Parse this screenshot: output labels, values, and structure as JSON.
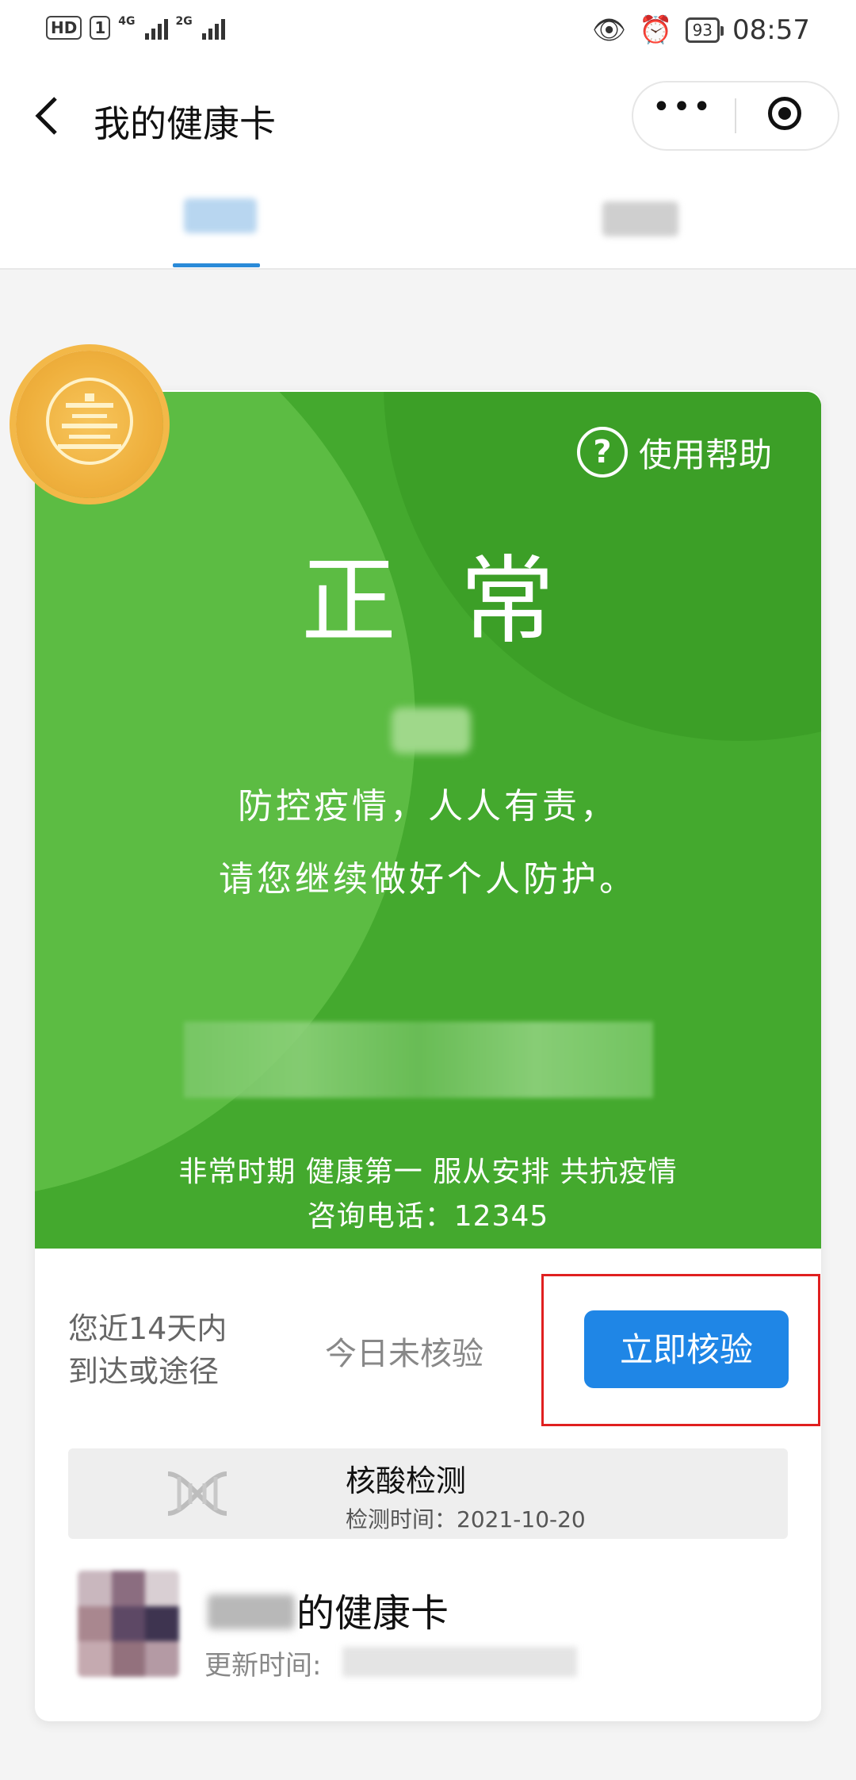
{
  "status_bar": {
    "hd": "HD",
    "sim": "1",
    "net1": "4G",
    "net2": "2G",
    "battery": "93",
    "time": "08:57"
  },
  "header": {
    "back_icon": "chevron-left-icon",
    "title": "我的健康卡",
    "more": "•••"
  },
  "card": {
    "help_label": "使用帮助",
    "status": "正常",
    "slogan_line1": "防控疫情，人人有责，",
    "slogan_line2": "请您继续做好个人防护。",
    "footer_line1": "非常时期 健康第一 服从安排 共抗疫情",
    "footer_line2": "咨询电话：12345",
    "color_primary": "#44a92e"
  },
  "verification": {
    "trip_line1": "您近14天内",
    "trip_line2": "到达或途径",
    "today_status": "今日未核验",
    "verify_button": "立即核验",
    "button_color": "#1f86e6"
  },
  "nucleic": {
    "title": "核酸检测",
    "time_label": "检测时间：",
    "time_value": "2021-10-20"
  },
  "owner": {
    "card_suffix": "的健康卡",
    "updated_label": "更新时间:"
  }
}
